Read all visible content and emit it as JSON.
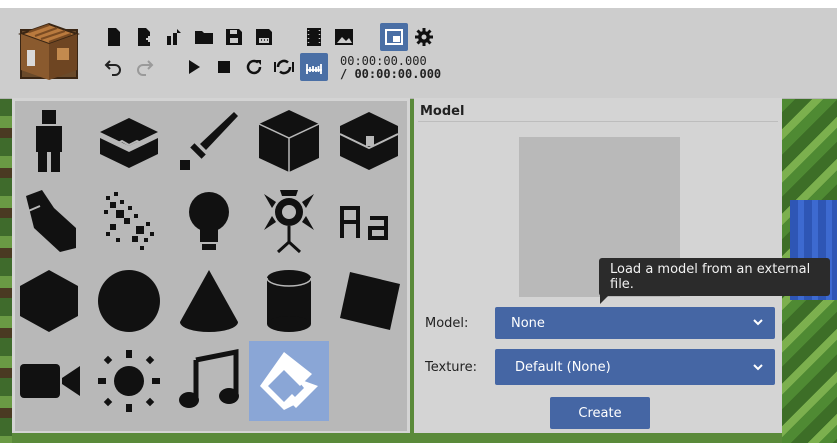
{
  "toolbar": {
    "buttons": [
      "new-file",
      "new-from-template",
      "import",
      "open-folder",
      "save",
      "save-as",
      "export-video",
      "export-image",
      "toggle-layout",
      "settings",
      "undo",
      "redo",
      "play",
      "stop",
      "loop",
      "sync",
      "timeline"
    ],
    "time_current": "00:00:00.000",
    "time_total": "/ 00:00:00.000"
  },
  "palette": {
    "items": [
      "character",
      "block",
      "item",
      "cube",
      "chest",
      "bodypart",
      "particles",
      "light",
      "camera",
      "text",
      "hexagon",
      "sphere",
      "cone",
      "cylinder",
      "surface",
      "video",
      "sun",
      "audio",
      "model"
    ],
    "selected": "model"
  },
  "panel": {
    "title": "Model",
    "model_label": "Model:",
    "model_value": "None",
    "texture_label": "Texture:",
    "texture_value": "Default (None)",
    "create_label": "Create"
  },
  "tooltip": {
    "text": "Load a model from an external file."
  },
  "colors": {
    "accent": "#4566a4",
    "selected_tile": "#8aa6d6",
    "toolbar_bg": "#cdcdcd"
  }
}
